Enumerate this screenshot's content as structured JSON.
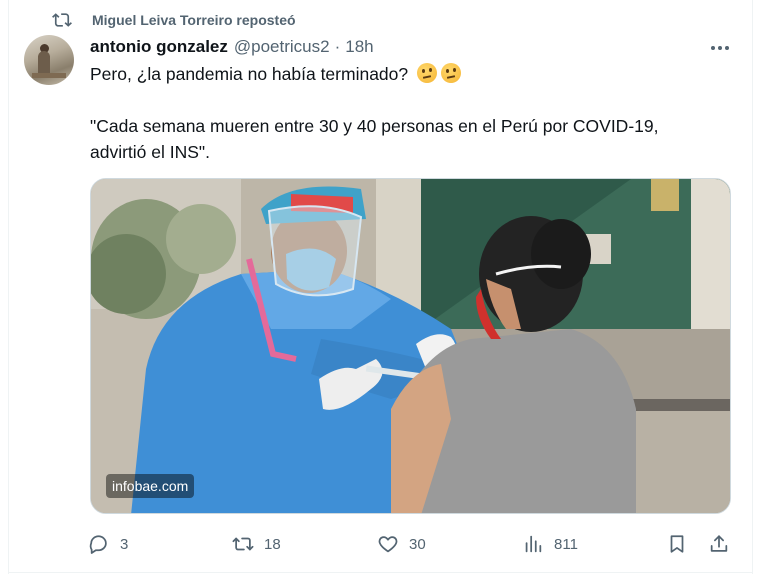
{
  "repost": {
    "text": "Miguel Leiva Torreiro reposteó",
    "icon": "repost-icon"
  },
  "tweet": {
    "author_name": "antonio gonzalez",
    "handle": "@poetricus2",
    "separator": "·",
    "time": "18h",
    "line1": "Pero, ¿la pandemia no había terminado?",
    "line1_emojis": [
      "thinking-face-emoji",
      "thinking-face-emoji"
    ],
    "line2": "\"Cada semana mueren entre 30 y 40 personas en el Perú por COVID-19,",
    "line3": "advirtió el INS\".",
    "media": {
      "watermark": "infobae.com"
    }
  },
  "actions": {
    "replies": "3",
    "reposts": "18",
    "likes": "30",
    "views": "811"
  },
  "colors": {
    "text_primary": "#0f1419",
    "text_secondary": "#536471",
    "border": "#cfd9de"
  }
}
